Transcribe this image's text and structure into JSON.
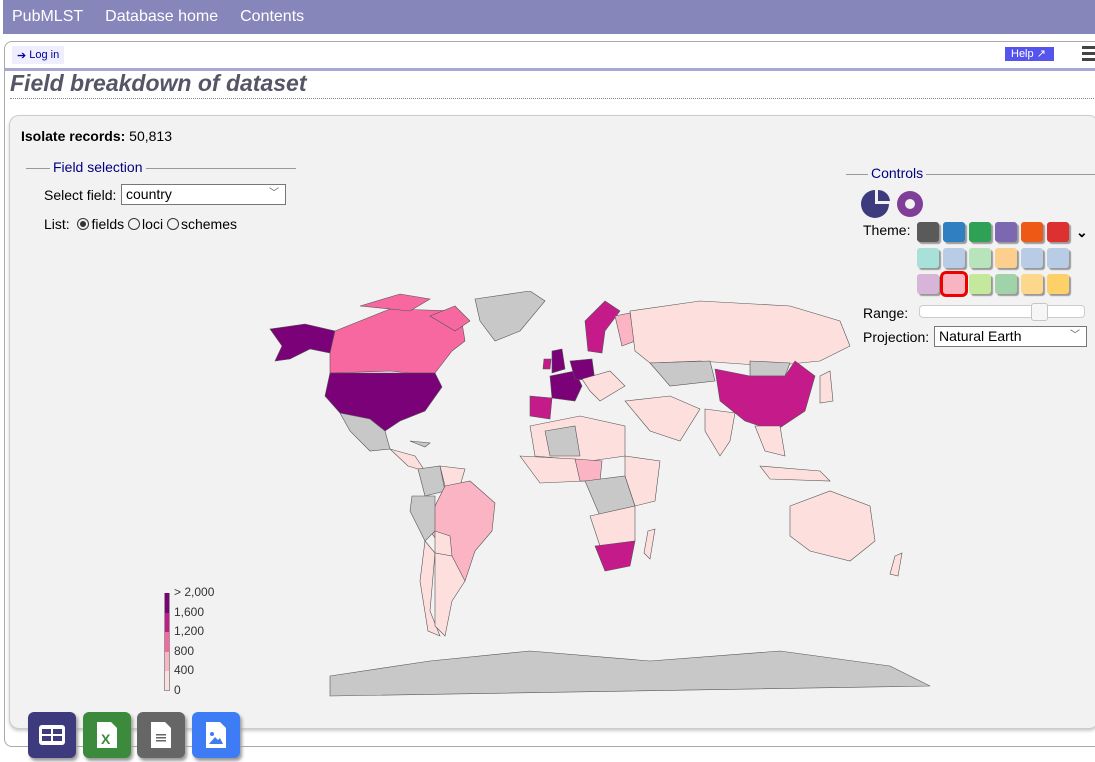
{
  "nav": {
    "items": [
      "PubMLST",
      "Database home",
      "Contents"
    ]
  },
  "header": {
    "login": "Log in",
    "help": "Help",
    "title": "Field breakdown of dataset"
  },
  "summary": {
    "label": "Isolate records:",
    "value": "50,813"
  },
  "field_selection": {
    "legend": "Field selection",
    "select_label": "Select field:",
    "select_value": "country",
    "list_label": "List:",
    "list_options": [
      "fields",
      "loci",
      "schemes"
    ],
    "list_selected": "fields"
  },
  "controls": {
    "legend": "Controls",
    "theme_label": "Theme:",
    "range_label": "Range:",
    "range_value": 0.75,
    "projection_label": "Projection:",
    "projection_value": "Natural Earth",
    "themes_row1": [
      "#5a5a5a",
      "#2f7fc1",
      "#2ea154",
      "#7b68b0",
      "#ee5a16",
      "#dd3030"
    ],
    "themes_row2": [
      "#a8e0da",
      "#b8cce6",
      "#b8e4bc",
      "#fccf8e",
      "#b8cce6",
      "#b8cce6"
    ],
    "themes_row3": [
      "#d8b4d8",
      "#f9b4c4",
      "#c4e89c",
      "#a0d4a8",
      "#fdd88c",
      "#fdd068"
    ],
    "selected_theme": "#f9b4c4"
  },
  "map_legend": {
    "labels": [
      "> 2,000",
      "1,600",
      "1,200",
      "800",
      "400",
      "0"
    ],
    "colors": [
      "#7a0177",
      "#c51b8a",
      "#f768a1",
      "#fbb4c4",
      "#fde0dd"
    ],
    "no_data": "#c8c8c8"
  },
  "export": {
    "buttons": [
      {
        "icon": "table-icon",
        "color": "#3e3a7e"
      },
      {
        "icon": "excel-icon",
        "color": "#3c8a3c"
      },
      {
        "icon": "text-file-icon",
        "color": "#666666"
      },
      {
        "icon": "image-file-icon",
        "color": "#3d7cf5"
      }
    ]
  }
}
